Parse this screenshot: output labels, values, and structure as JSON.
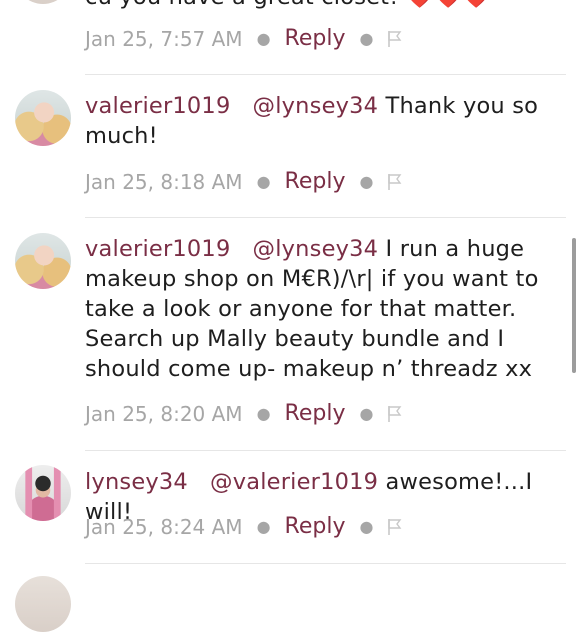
{
  "comments": [
    {
      "id": "c0",
      "text_partial": "cu you have a great closet! ❤️❤️❤️",
      "time": "Jan 25, 7:57 AM",
      "reply_label": "Reply"
    },
    {
      "id": "c1",
      "username": "valerier1019",
      "mention": "@lynsey34",
      "text": "Thank you so much!",
      "time": "Jan 25, 8:18 AM",
      "reply_label": "Reply"
    },
    {
      "id": "c2",
      "username": "valerier1019",
      "mention": "@lynsey34",
      "text": "I run a huge makeup shop on M€R)/\\r| if you want to take a look or anyone for that matter. Search up Mally beauty bundle and I should come up- makeup n’ threadz xx",
      "time": "Jan 25, 8:20 AM",
      "reply_label": "Reply"
    },
    {
      "id": "c3",
      "username": "lynsey34",
      "mention": "@valerier1019",
      "text": "awesome!...I will!",
      "time": "Jan 25, 8:24 AM",
      "reply_label": "Reply"
    }
  ],
  "icons": {
    "flag": "flag-icon",
    "separator": "dot-separator"
  },
  "colors": {
    "accent": "#7a2e45",
    "muted": "#a6a6a6",
    "text": "#1e1e1e",
    "divider": "#e6e6e6"
  }
}
